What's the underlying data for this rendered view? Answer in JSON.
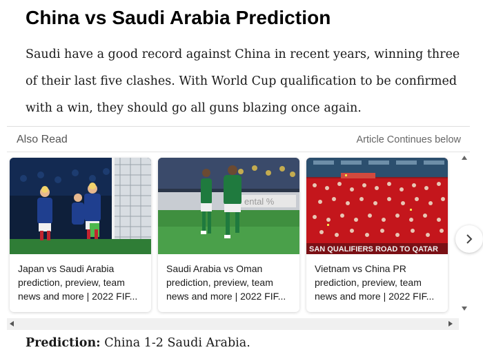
{
  "article": {
    "title": "China vs Saudi Arabia Prediction",
    "intro": "Saudi have a good record against China in recent years, winning three of their last five clashes. With World Cup qualification to be confirmed with a win, they should go all guns blazing once again.",
    "prediction_label": "Prediction:",
    "prediction_text": " China 1-2 Saudi Arabia."
  },
  "also_read": {
    "label": "Also Read",
    "continues_label": "Article Continues below",
    "cards": [
      {
        "caption": "Japan vs Saudi Arabia prediction, preview, team news and more | 2022 FIF..."
      },
      {
        "caption": "Saudi Arabia vs Oman prediction, preview, team news and more | 2022 FIF..."
      },
      {
        "caption": "Vietnam vs China PR prediction, preview, team news and more | 2022 FIF...",
        "banner_text": "SAN QUALIFIERS ROAD TO QATAR"
      }
    ]
  },
  "colors": {
    "japan_blue": "#1f3f8f",
    "saudi_green": "#1f7a3e",
    "crowd_red": "#b8141a",
    "pitch": "#2f8a3a"
  },
  "icons": {
    "next": "chevron-right-icon",
    "scroll_up": "triangle-up-icon",
    "scroll_down": "triangle-down-icon",
    "scroll_left": "triangle-left-icon",
    "scroll_right": "triangle-right-icon"
  }
}
